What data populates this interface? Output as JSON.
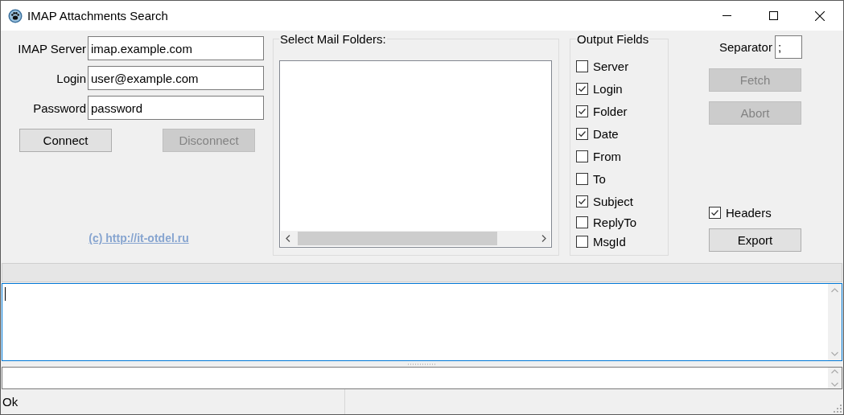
{
  "window": {
    "title": "IMAP Attachments Search"
  },
  "connection": {
    "fields": [
      {
        "label": "IMAP Server",
        "value": "imap.example.com"
      },
      {
        "label": "Login",
        "value": "user@example.com"
      },
      {
        "label": "Password",
        "value": "password"
      }
    ],
    "buttons": [
      {
        "label": "Connect",
        "disabled": false
      },
      {
        "label": "Disconnect",
        "disabled": true
      }
    ],
    "link": "(c) http://it-otdel.ru"
  },
  "folders": {
    "title": "Select Mail Folders:"
  },
  "output_fields": {
    "title": "Output Fields",
    "items": [
      {
        "label": "Server",
        "checked": false
      },
      {
        "label": "Login",
        "checked": true
      },
      {
        "label": "Folder",
        "checked": true
      },
      {
        "label": "Date",
        "checked": true
      },
      {
        "label": "From",
        "checked": false
      },
      {
        "label": "To",
        "checked": false
      },
      {
        "label": "Subject",
        "checked": true
      },
      {
        "label": "ReplyTo",
        "checked": false
      },
      {
        "label": "MsgId",
        "checked": false
      }
    ]
  },
  "separator": {
    "label": "Separator",
    "value": ";"
  },
  "actions": [
    {
      "label": "Fetch",
      "disabled": true
    },
    {
      "label": "Abort",
      "disabled": true
    }
  ],
  "headers": {
    "label": "Headers",
    "checked": true
  },
  "export": {
    "label": "Export",
    "disabled": false
  },
  "progress": {
    "level": 0
  },
  "status_bar": {
    "text": "Ok"
  }
}
